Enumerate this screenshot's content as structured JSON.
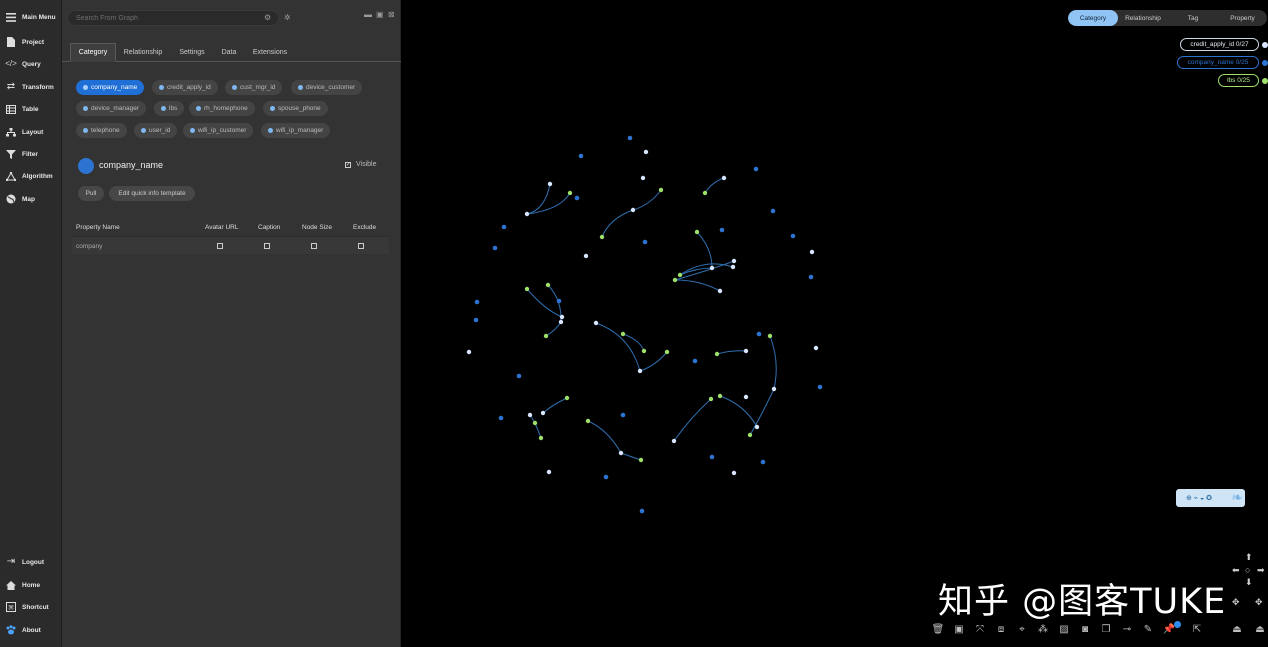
{
  "nav": {
    "top": [
      {
        "label": "Main Menu",
        "icon": "hamburger-icon"
      },
      {
        "label": "Project",
        "icon": "file-icon"
      },
      {
        "label": "Query",
        "icon": "code-icon"
      },
      {
        "label": "Transform",
        "icon": "arrows-icon"
      },
      {
        "label": "Table",
        "icon": "table-icon"
      },
      {
        "label": "Layout",
        "icon": "hierarchy-icon"
      },
      {
        "label": "Filter",
        "icon": "filter-icon"
      },
      {
        "label": "Algorithm",
        "icon": "algorithm-icon"
      },
      {
        "label": "Map",
        "icon": "globe-icon"
      }
    ],
    "bottom": [
      {
        "label": "Logout",
        "icon": "logout-icon"
      },
      {
        "label": "Home",
        "icon": "home-icon"
      },
      {
        "label": "Shortcut",
        "icon": "shortcut-icon"
      },
      {
        "label": "About",
        "icon": "paw-icon"
      }
    ]
  },
  "panel": {
    "search_placeholder": "Search From Graph",
    "tabs": [
      "Category",
      "Relationship",
      "Settings",
      "Data",
      "Extensions"
    ],
    "active_tab": "Category",
    "categories": [
      "company_name",
      "credit_apply_id",
      "cust_mgr_id",
      "device_customer",
      "device_manager",
      "lbs",
      "rh_homephone",
      "spouse_phone",
      "telephone",
      "user_id",
      "wifi_ip_customer",
      "wifi_ip_manager"
    ],
    "selected": {
      "name": "company_name",
      "visible_label": "Visible",
      "color": "#2d73d1"
    },
    "buttons": {
      "pull": "Pull",
      "edit": "Edit quick info template"
    },
    "table": {
      "headers": [
        "Property Name",
        "Avatar URL",
        "Caption",
        "Node Size",
        "Exclude"
      ],
      "rows": [
        {
          "name": "company"
        }
      ]
    }
  },
  "graph": {
    "segments": [
      "Category",
      "Relationship",
      "Tag",
      "Property"
    ],
    "active_segment": "Category",
    "legend": [
      {
        "label": "credit_apply_id 0/27",
        "color": "#d9e6ff"
      },
      {
        "label": "company_name 0/25",
        "color": "#2d73d1"
      },
      {
        "label": "lbs 0/25",
        "color": "#9ee06a"
      }
    ],
    "colors": {
      "light": "#d9e6ff",
      "blue": "#2d73d1",
      "green": "#9ee06a",
      "edge": "#2f6fb0"
    }
  },
  "watermark": "知乎 @图客TUKE"
}
